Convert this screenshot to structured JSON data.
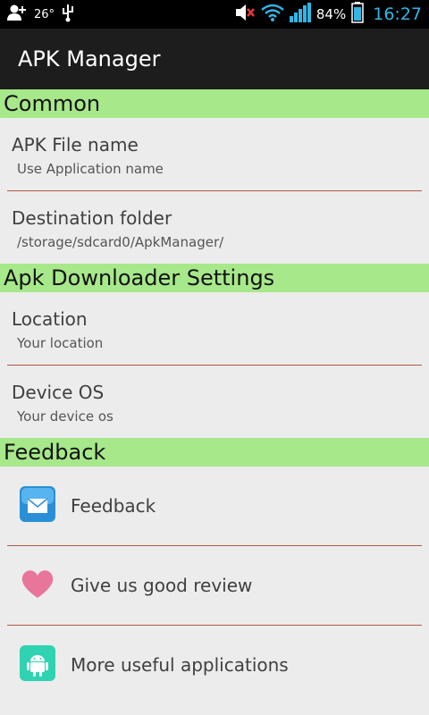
{
  "status_bar": {
    "temperature": "26°",
    "battery_percent": "84%",
    "time": "16:27",
    "icons": [
      "add-contact-icon",
      "usb-icon",
      "mute-icon",
      "wifi-icon",
      "signal-icon",
      "battery-icon"
    ]
  },
  "app": {
    "title": "APK Manager"
  },
  "sections": {
    "common": {
      "header": "Common",
      "items": [
        {
          "title": "APK File name",
          "summary": "Use Application name"
        },
        {
          "title": "Destination folder",
          "summary": "/storage/sdcard0/ApkManager/"
        }
      ]
    },
    "downloader": {
      "header": "Apk Downloader Settings",
      "items": [
        {
          "title": "Location",
          "summary": "Your location"
        },
        {
          "title": "Device OS",
          "summary": "Your device os"
        }
      ]
    },
    "feedback": {
      "header": "Feedback",
      "items": [
        {
          "label": "Feedback",
          "icon": "mail-icon"
        },
        {
          "label": "Give us good review",
          "icon": "heart-icon"
        },
        {
          "label": "More useful applications",
          "icon": "android-icon"
        }
      ]
    }
  },
  "colors": {
    "section_bg": "#a7e88a",
    "divider": "#b05a44",
    "accent_time": "#33b5e5"
  }
}
